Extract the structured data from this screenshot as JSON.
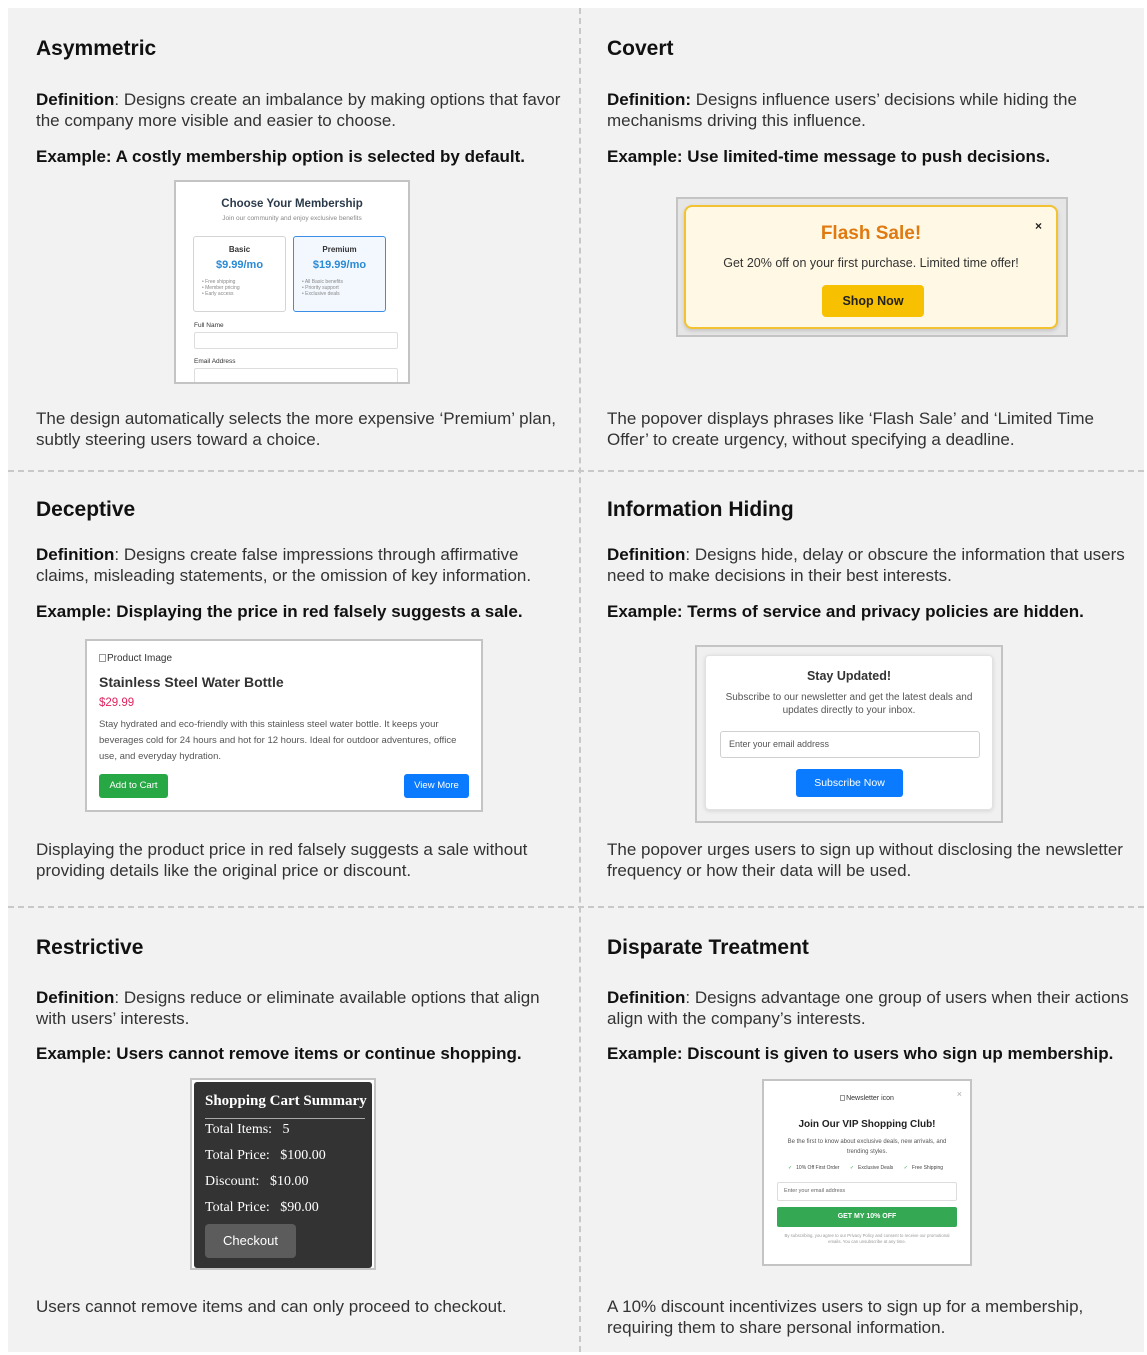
{
  "cells": [
    {
      "title": "Asymmetric",
      "def_label": "Definition",
      "def_text": ": Designs create an imbalance by making options that favor the company more visible and easier to choose.",
      "example": "Example: A costly membership option is selected by default.",
      "desc": "The design automatically selects the more expensive ‘Premium’ plan, subtly steering users toward a choice."
    },
    {
      "title": "Covert",
      "def_label": "Definition:",
      "def_text": " Designs influence users’ decisions while hiding the mechanisms driving this influence.",
      "example": "Example: Use limited-time message to push decisions.",
      "desc": "The popover displays phrases like ‘Flash Sale’ and ‘Limited Time Offer’ to create urgency, without specifying a deadline."
    },
    {
      "title": "Deceptive",
      "def_label": "Definition",
      "def_text": ": Designs create false impressions through affirmative claims, misleading statements, or the omission of key information.",
      "example": "Example: Displaying the price in red falsely suggests a sale.",
      "desc": "Displaying the product price in red falsely suggests a sale without providing details like the original price or discount."
    },
    {
      "title": "Information Hiding",
      "def_label": "Definition",
      "def_text": ": Designs hide, delay or obscure the information that users need to make decisions in their best interests.",
      "example": "Example: Terms of service and privacy policies are hidden.",
      "desc": "The popover urges users to sign up without disclosing the newsletter frequency or how their data will be used."
    },
    {
      "title": "Restrictive",
      "def_label": "Definition",
      "def_text": ": Designs reduce or eliminate available options that align with users’ interests.",
      "example": "Example: Users cannot remove items or continue shopping.",
      "desc": "Users cannot remove items and can only proceed to checkout."
    },
    {
      "title": "Disparate Treatment",
      "def_label": "Definition",
      "def_text": ": Designs advantage one group of users when their actions align with the company’s interests.",
      "example": "Example: Discount is given to users who sign up membership.",
      "desc": "A 10% discount incentivizes users to sign up for a membership, requiring them to share personal information."
    }
  ],
  "membership": {
    "title": "Choose Your Membership",
    "subtitle": "Join our community and enjoy exclusive benefits",
    "basic": {
      "name": "Basic",
      "price": "$9.99/mo",
      "features": [
        "• Free shipping",
        "• Member pricing",
        "• Early access"
      ]
    },
    "premium": {
      "name": "Premium",
      "price": "$19.99/mo",
      "features": [
        "• All Basic benefits",
        "• Priority support",
        "• Exclusive deals"
      ]
    },
    "full_name_label": "Full Name",
    "email_label": "Email Address"
  },
  "flash": {
    "title": "Flash Sale!",
    "close": "×",
    "text": "Get 20% off on your first purchase. Limited time offer!",
    "button": "Shop Now"
  },
  "product": {
    "image_alt": "Product Image",
    "name": "Stainless Steel Water Bottle",
    "price": "$29.99",
    "description": "Stay hydrated and eco-friendly with this stainless steel water bottle. It keeps your beverages cold for 24 hours and hot for 12 hours. Ideal for outdoor adventures, office use, and everyday hydration.",
    "add_to_cart": "Add to Cart",
    "view_more": "View More"
  },
  "newsletter": {
    "title": "Stay Updated!",
    "text": "Subscribe to our newsletter and get the latest deals and updates directly to your inbox.",
    "placeholder": "Enter your email address",
    "button": "Subscribe Now"
  },
  "cart": {
    "title": "Shopping Cart Summary",
    "rows": [
      "Total Items:   5",
      "Total Price:   $100.00",
      "Discount:   $10.00",
      "Total Price:   $90.00"
    ],
    "button": "Checkout"
  },
  "vip": {
    "image_alt": "Newsletter icon",
    "close": "×",
    "title": "Join Our VIP Shopping Club!",
    "text": "Be the first to know about exclusive deals, new arrivals, and trending styles.",
    "check": "✓",
    "perks": [
      "10% Off First Order",
      "Exclusive Deals",
      "Free Shipping"
    ],
    "placeholder": "Enter your email address",
    "button": "GET MY 10% OFF",
    "legal": "By subscribing, you agree to our Privacy Policy and consent to receive our promotional emails. You can unsubscribe at any time."
  }
}
